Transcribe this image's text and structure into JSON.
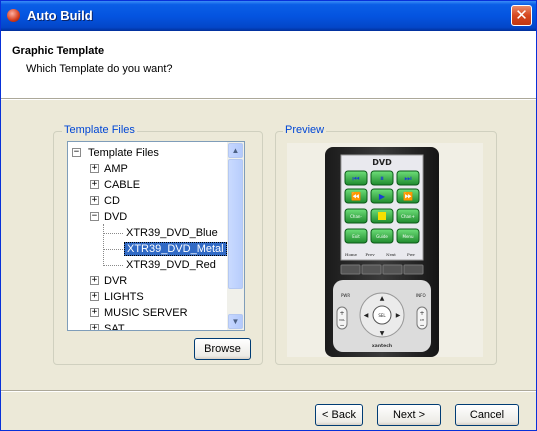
{
  "window": {
    "title": "Auto Build",
    "close_glyph": "✕"
  },
  "header": {
    "title": "Graphic Template",
    "subtitle": "Which Template do you want?"
  },
  "template_files": {
    "group_label": "Template Files",
    "tree": [
      {
        "label": "Template Files",
        "expander": "−"
      },
      {
        "label": "AMP",
        "expander": "+"
      },
      {
        "label": "CABLE",
        "expander": "+"
      },
      {
        "label": "CD",
        "expander": "+"
      },
      {
        "label": "DVD",
        "expander": "−"
      },
      {
        "label": "XTR39_DVD_Blue"
      },
      {
        "label": "XTR39_DVD_Metal",
        "selected": true
      },
      {
        "label": "XTR39_DVD_Red"
      },
      {
        "label": "DVR",
        "expander": "+"
      },
      {
        "label": "LIGHTS",
        "expander": "+"
      },
      {
        "label": "MUSIC SERVER",
        "expander": "+"
      },
      {
        "label": "SAT",
        "expander": "+"
      }
    ],
    "browse_label": "Browse"
  },
  "preview": {
    "group_label": "Preview",
    "screen_title": "DVD",
    "soft_keys": [
      "Home",
      "Prev",
      "Next",
      "Pwr"
    ],
    "side_left_top": "PWR",
    "side_right_top": "INFO",
    "vol_label": "VOL",
    "ch_label": "CH",
    "center_label": "SEL",
    "brand": "xantech",
    "button_row_labels": [
      "Chan-",
      "Chan+",
      "Exit",
      "Guide",
      "Menu"
    ]
  },
  "footer": {
    "back_label": "< Back",
    "next_label": "Next >",
    "cancel_label": "Cancel"
  },
  "colors": {
    "title_bar": "#0454e0",
    "selection": "#316ac5",
    "group_label": "#0046d5",
    "remote_button": "#2a9a3a"
  }
}
